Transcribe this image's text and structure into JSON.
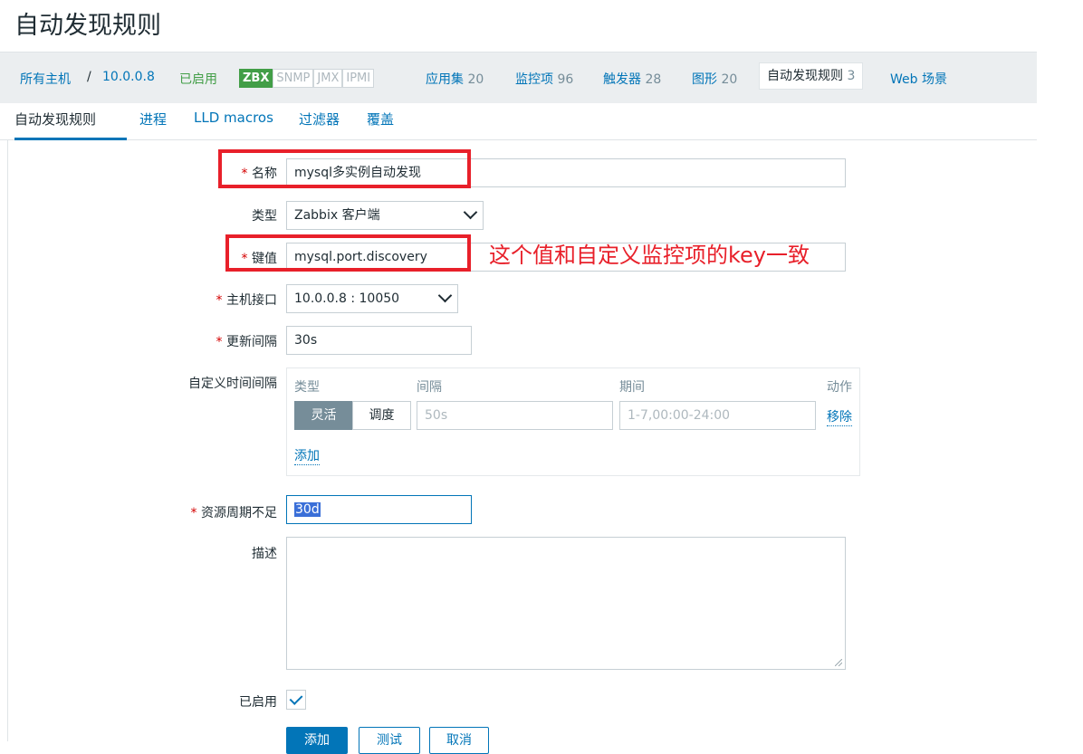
{
  "page_title": "自动发现规则",
  "host_nav": {
    "all_hosts": "所有主机",
    "separator": "/",
    "host": "10.0.0.8",
    "status": "已启用",
    "availability": [
      "ZBX",
      "SNMP",
      "JMX",
      "IPMI"
    ],
    "links": [
      {
        "label": "应用集",
        "count": "20"
      },
      {
        "label": "监控项",
        "count": "96"
      },
      {
        "label": "触发器",
        "count": "28"
      },
      {
        "label": "图形",
        "count": "20"
      }
    ],
    "active_tab": {
      "label": "自动发现规则",
      "count": "3"
    },
    "web": "Web 场景"
  },
  "subtabs": [
    "自动发现规则",
    "进程",
    "LLD macros",
    "过滤器",
    "覆盖"
  ],
  "form": {
    "required_mark": "*",
    "name": {
      "label": "名称",
      "value": "mysql多实例自动发现"
    },
    "type": {
      "label": "类型",
      "value": "Zabbix 客户端"
    },
    "key": {
      "label": "键值",
      "value": "mysql.port.discovery"
    },
    "interface": {
      "label": "主机接口",
      "value": "10.0.0.8 : 10050"
    },
    "update_interval": {
      "label": "更新间隔",
      "value": "30s"
    },
    "custom_intervals": {
      "label": "自定义时间间隔",
      "headers": {
        "type": "类型",
        "interval": "间隔",
        "period": "期间",
        "action": "动作"
      },
      "flexible": "灵活",
      "scheduling": "调度",
      "interval_placeholder": "50s",
      "period_placeholder": "1-7,00:00-24:00",
      "remove": "移除",
      "add": "添加"
    },
    "lifetime": {
      "label": "资源周期不足",
      "value": "30d"
    },
    "description": {
      "label": "描述",
      "value": ""
    },
    "enabled": {
      "label": "已启用",
      "checked": true
    }
  },
  "annotation": "这个值和自定义监控项的key一致",
  "buttons": {
    "add": "添加",
    "test": "测试",
    "cancel": "取消"
  },
  "colors": {
    "accent": "#0275b8",
    "annotation_red": "#e8202a",
    "enabled_green": "#429e47"
  }
}
